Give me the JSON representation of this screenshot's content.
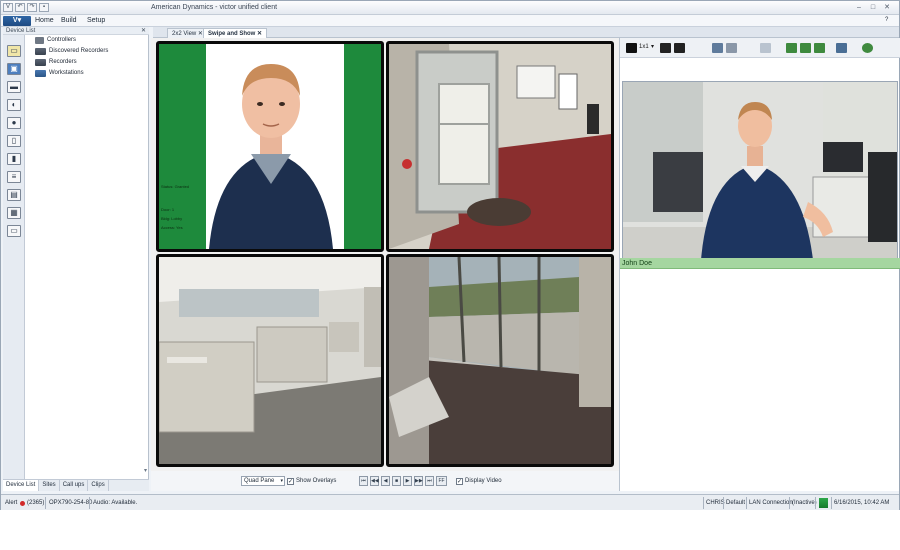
{
  "window": {
    "title": "American Dynamics - victor unified client",
    "controls": [
      "–",
      "□",
      "✕"
    ]
  },
  "menu": {
    "logo": "V",
    "items": [
      "Home",
      "Build",
      "Setup"
    ]
  },
  "device_list": {
    "header": "Device List",
    "close": "✕",
    "items": [
      "Controllers",
      "Discovered Recorders",
      "Recorders",
      "Workstations"
    ]
  },
  "bottom_tabs": [
    "Device List",
    "Sites",
    "Call ups",
    "Clips"
  ],
  "doc_tabs": [
    {
      "label": "2x2 View ✕",
      "active": false
    },
    {
      "label": "Swipe and Show ✕",
      "active": true
    }
  ],
  "badge": {
    "lines": [
      "Status: Granted",
      "Door: 1",
      "Bldg: Lobby",
      "Access: Yes"
    ]
  },
  "controls": {
    "layout_select": "Quad Pane",
    "show_overlays_label": "Show Overlays",
    "show_overlays_checked": true,
    "display_video_label": "Display Video",
    "display_video_checked": true,
    "nav_buttons": [
      "⏮",
      "◀◀",
      "◀",
      "■",
      "▶",
      "▶▶",
      "⏭",
      "FF"
    ]
  },
  "right_panel": {
    "layout_label": "1x1",
    "person_name": "John Doe"
  },
  "status_bar": {
    "alert": "Alert",
    "alert_count": "(2365)",
    "host": "OPX790-254-80",
    "audio": "Audio: Available.",
    "user": "CHRIS",
    "profile": "Default",
    "connection": "LAN Connection",
    "state": "(Inactive)",
    "datetime": "6/16/2015, 10:42 AM"
  },
  "colors": {
    "accent_blue": "#2f66a6",
    "badge_green": "#1e8a3c",
    "name_bar_green": "#a5d6a0",
    "carpet_red": "#8a2e2e"
  }
}
